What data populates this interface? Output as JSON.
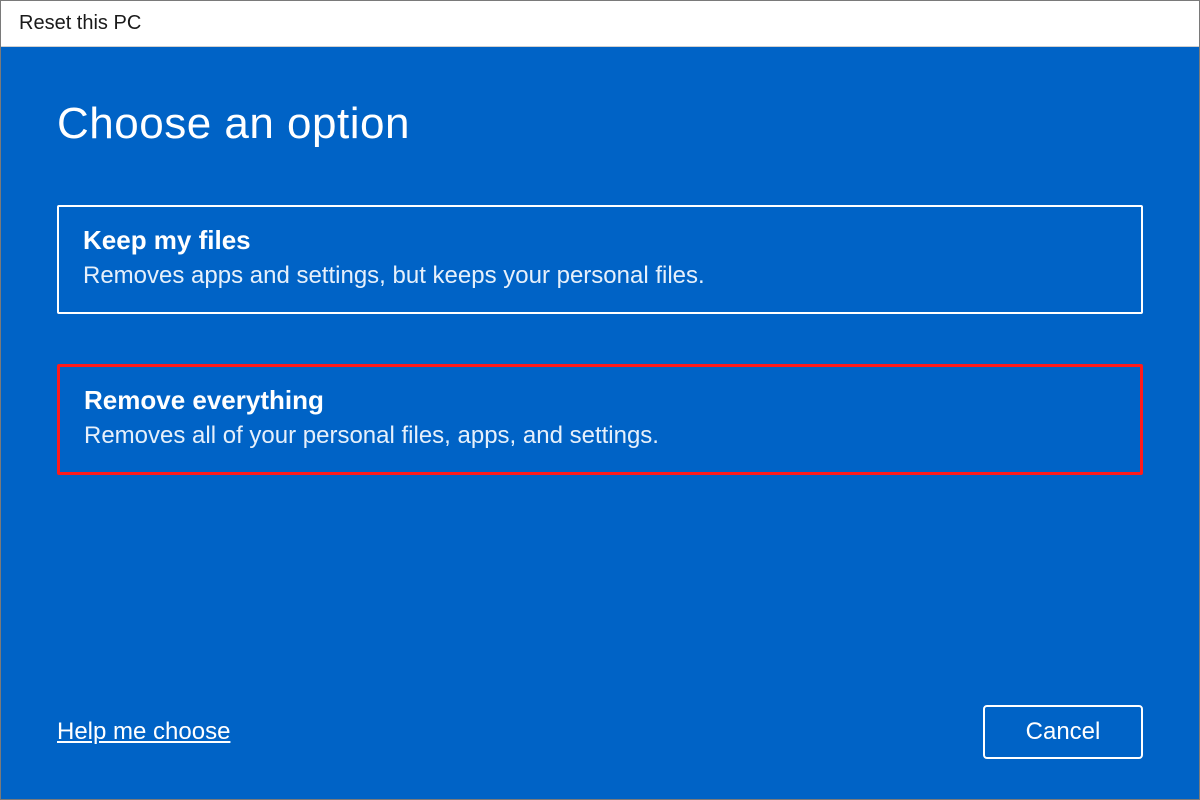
{
  "window": {
    "title": "Reset this PC"
  },
  "page": {
    "heading": "Choose an option"
  },
  "options": [
    {
      "title": "Keep my files",
      "description": "Removes apps and settings, but keeps your personal files.",
      "highlighted": false
    },
    {
      "title": "Remove everything",
      "description": "Removes all of your personal files, apps, and settings.",
      "highlighted": true
    }
  ],
  "footer": {
    "help_link": "Help me choose",
    "cancel_label": "Cancel"
  }
}
